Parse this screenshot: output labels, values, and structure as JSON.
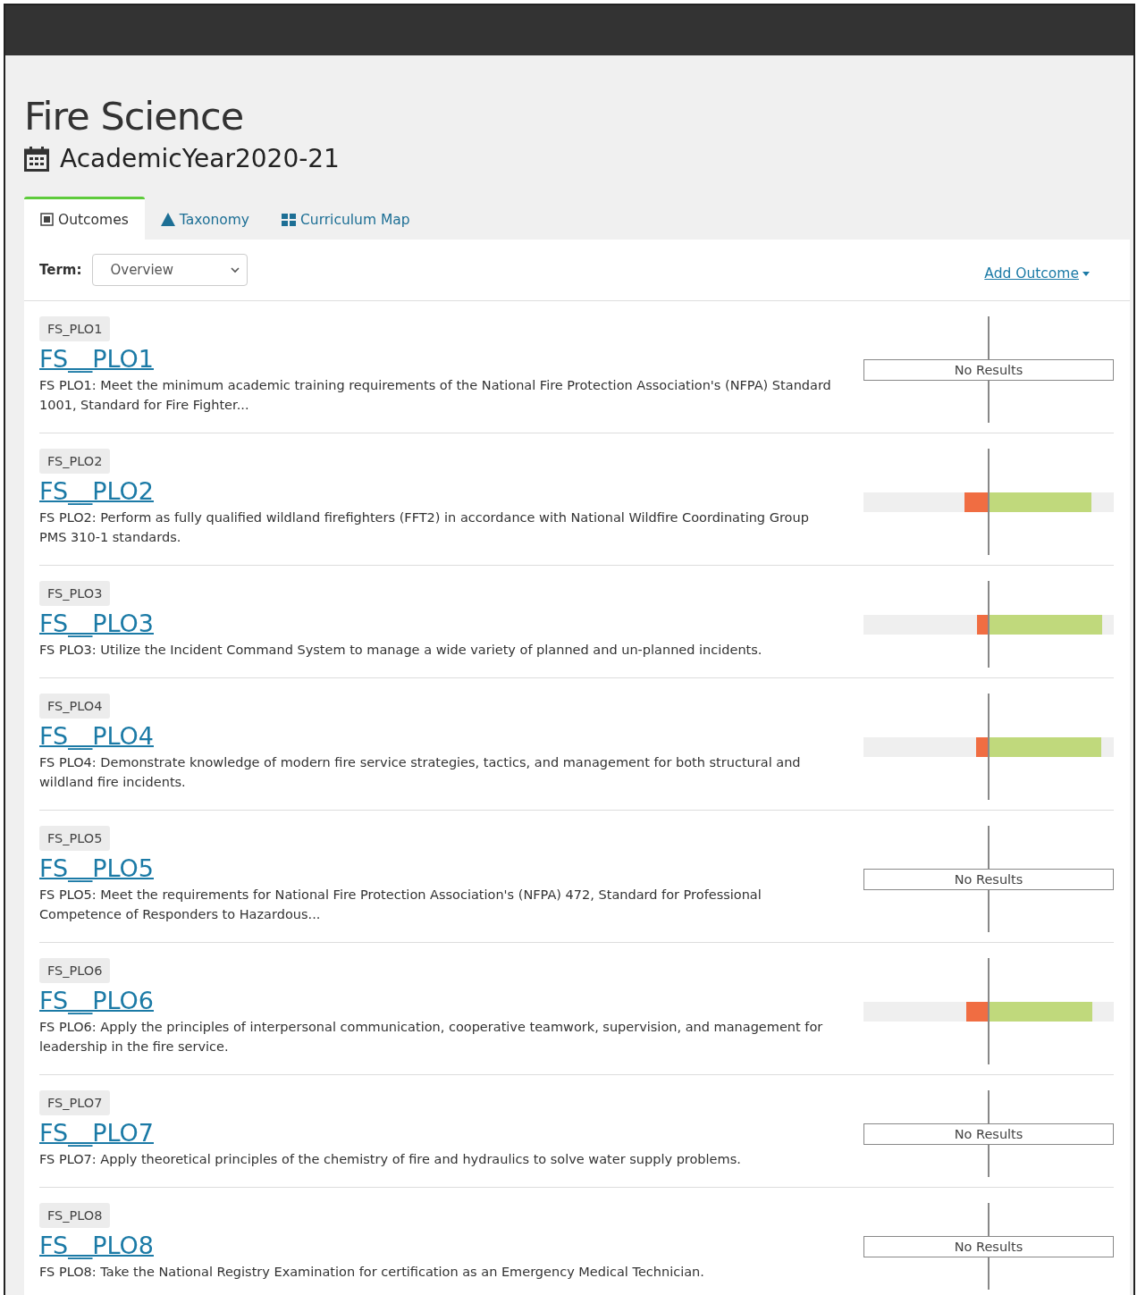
{
  "program": {
    "title": "Fire Science",
    "year": "AcademicYear2020-21"
  },
  "tabs": [
    {
      "label": "Outcomes",
      "selected": true
    },
    {
      "label": "Taxonomy",
      "selected": false
    },
    {
      "label": "Curriculum Map",
      "selected": false
    }
  ],
  "toolbar": {
    "term_label": "Term:",
    "term_value": "Overview",
    "add_link": "Add Outcome"
  },
  "outcomes": [
    {
      "code": "FS_PLO1",
      "title": "FS__PLO1",
      "description": "FS PLO1: Meet the minimum academic training requirements of the National Fire Protection Association's (NFPA) Standard 1001, Standard for Fire Fighter...",
      "result": {
        "kind": "none",
        "text": "No Results"
      }
    },
    {
      "code": "FS_PLO2",
      "title": "FS__PLO2",
      "description": "FS PLO2: Perform as fully qualified wildland firefighters (FFT2) in accordance with National Wildfire Coordinating Group PMS 310-1 standards.",
      "result": {
        "kind": "bar",
        "below": {
          "level": 0.19
        },
        "above": {
          "level": 0.82
        }
      }
    },
    {
      "code": "FS_PLO3",
      "title": "FS__PLO3",
      "description": "FS PLO3: Utilize the Incident Command System to manage a wide variety of planned and un-planned incidents.",
      "result": {
        "kind": "bar",
        "below": {
          "level": 0.09
        },
        "above": {
          "level": 0.91
        }
      }
    },
    {
      "code": "FS_PLO4",
      "title": "FS__PLO4",
      "description": "FS PLO4: Demonstrate knowledge of modern fire service strategies, tactics, and management for both structural and wildland fire incidents.",
      "result": {
        "kind": "bar",
        "below": {
          "level": 0.1
        },
        "above": {
          "level": 0.9
        }
      }
    },
    {
      "code": "FS_PLO5",
      "title": "FS__PLO5",
      "description": "FS PLO5: Meet the requirements for National Fire Protection Association's (NFPA) 472, Standard for Professional Competence of Responders to Hazardous...",
      "result": {
        "kind": "none",
        "text": "No Results"
      }
    },
    {
      "code": "FS_PLO6",
      "title": "FS__PLO6",
      "description": "FS PLO6: Apply the principles of interpersonal communication, cooperative teamwork, supervision, and management for leadership in the fire service.",
      "result": {
        "kind": "bar",
        "below": {
          "level": 0.18
        },
        "above": {
          "level": 0.83
        }
      }
    },
    {
      "code": "FS_PLO7",
      "title": "FS__PLO7",
      "description": "FS PLO7: Apply theoretical principles of the chemistry of fire and hydraulics to solve water supply problems.",
      "result": {
        "kind": "none",
        "text": "No Results"
      }
    },
    {
      "code": "FS_PLO8",
      "title": "FS__PLO8",
      "description": "FS PLO8: Take the National Registry Examination for certification as an Emergency Medical Technician.",
      "result": {
        "kind": "none",
        "text": "No Results"
      }
    }
  ]
}
